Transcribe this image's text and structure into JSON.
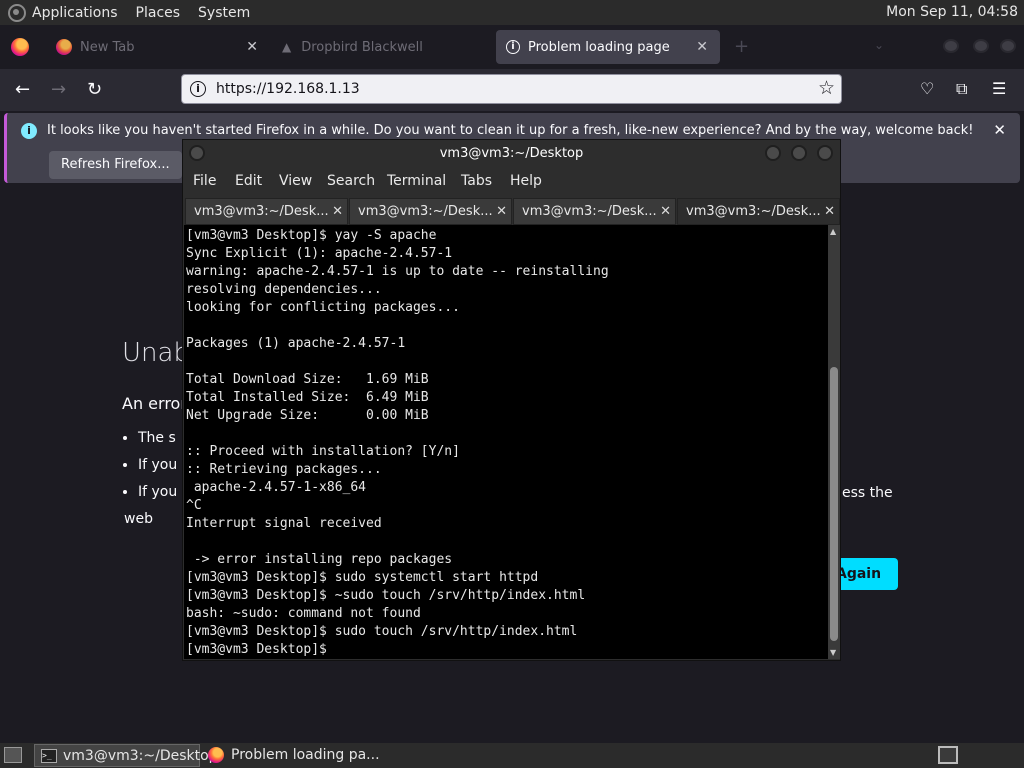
{
  "top_panel": {
    "menus": [
      "Applications",
      "Places",
      "System"
    ],
    "clock": "Mon Sep 11, 04:58"
  },
  "browser": {
    "tabs": [
      {
        "label": "New Tab"
      },
      {
        "label": "Dropbird Blackwell"
      },
      {
        "label": "Problem loading page",
        "active": true
      }
    ],
    "new_tab_glyph": "+",
    "url": "https://192.168.1.13",
    "notification": {
      "text": "It looks like you haven't started Firefox in a while. Do you want to clean it up for a fresh, like-new experience? And by the way, welcome back!",
      "button": "Refresh Firefox..."
    },
    "page": {
      "title_partial": "Unab",
      "desc_partial": "An error",
      "bullets": [
        "The s",
        "If you",
        "If you"
      ],
      "bullet3_line2": "web",
      "bullet3_tail": "ess the",
      "try_again_partial": "Again"
    }
  },
  "terminal": {
    "title": "vm3@vm3:~/Desktop",
    "menus": [
      "File",
      "Edit",
      "View",
      "Search",
      "Terminal",
      "Tabs",
      "Help"
    ],
    "tabs": [
      "vm3@vm3:~/Desk...",
      "vm3@vm3:~/Desk...",
      "vm3@vm3:~/Desk...",
      "vm3@vm3:~/Desk..."
    ],
    "active_tab_index": 3,
    "output": "[vm3@vm3 Desktop]$ yay -S apache\nSync Explicit (1): apache-2.4.57-1\nwarning: apache-2.4.57-1 is up to date -- reinstalling\nresolving dependencies...\nlooking for conflicting packages...\n\nPackages (1) apache-2.4.57-1\n\nTotal Download Size:   1.69 MiB\nTotal Installed Size:  6.49 MiB\nNet Upgrade Size:      0.00 MiB\n\n:: Proceed with installation? [Y/n]\n:: Retrieving packages...\n apache-2.4.57-1-x86_64\n^C\nInterrupt signal received\n\n -> error installing repo packages\n[vm3@vm3 Desktop]$ sudo systemctl start httpd\n[vm3@vm3 Desktop]$ ~sudo touch /srv/http/index.html\nbash: ~sudo: command not found\n[vm3@vm3 Desktop]$ sudo touch /srv/http/index.html\n[vm3@vm3 Desktop]$"
  },
  "taskbar": {
    "tasks": [
      {
        "label": "vm3@vm3:~/Desktop",
        "active": true
      },
      {
        "label": "Problem loading pa..."
      }
    ]
  }
}
